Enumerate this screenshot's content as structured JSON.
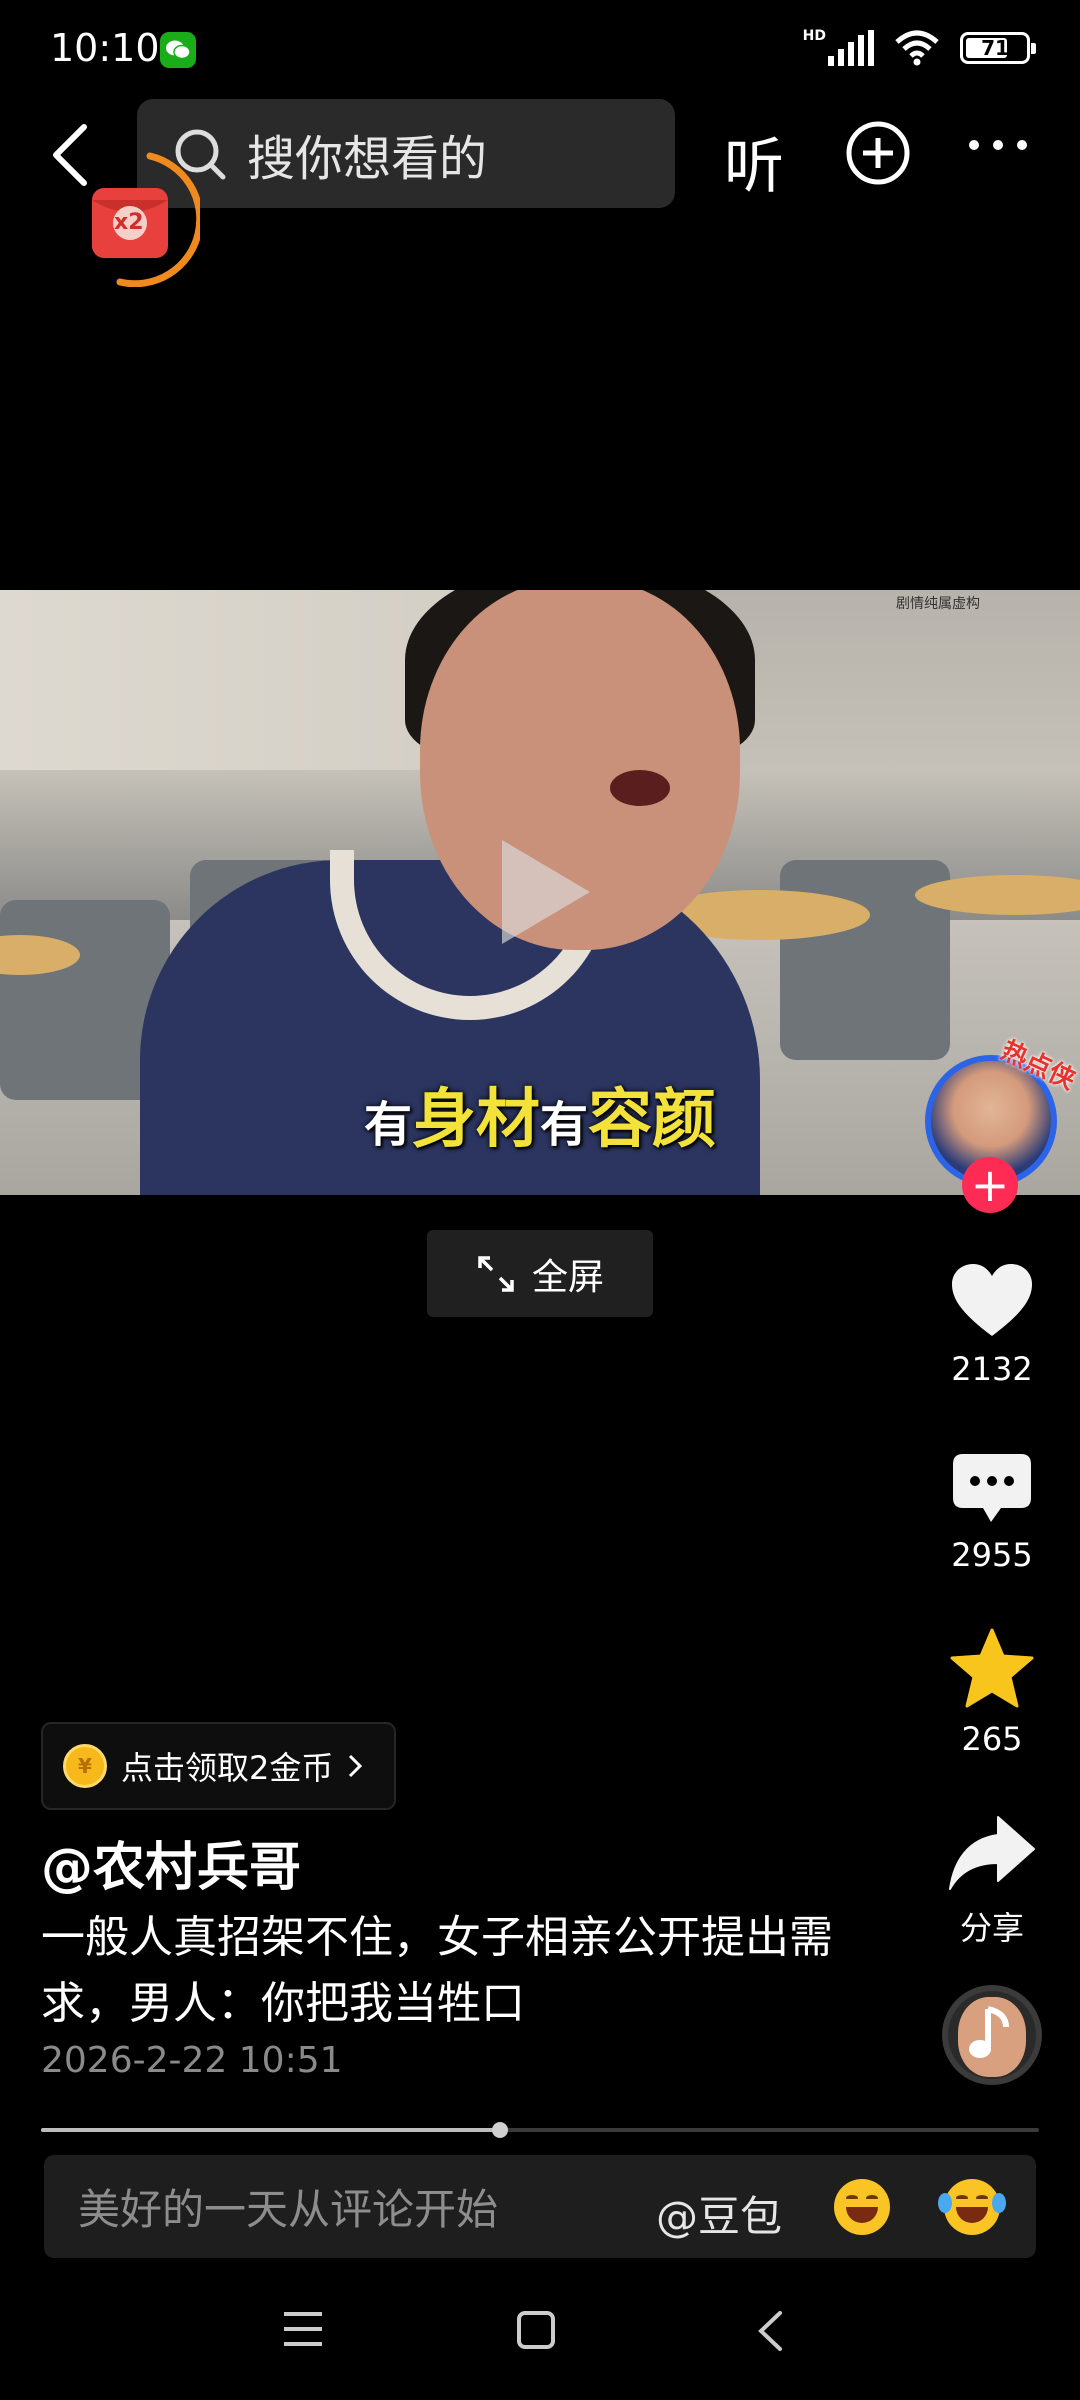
{
  "status_bar": {
    "time": "10:10",
    "network": "HD",
    "battery": "71",
    "battery_level": 0.71
  },
  "top_nav": {
    "search_placeholder": "搜你想看的",
    "listen_label": "听",
    "coin_badge_text": "x2"
  },
  "video": {
    "subtitle_part1": "有",
    "subtitle_part2": "身材",
    "subtitle_part3": "有",
    "subtitle_part4": "容颜",
    "watermark": "剧情纯属虚构",
    "fullscreen_label": "全屏"
  },
  "rail": {
    "hot_tag": "热点侠",
    "like_count": "2132",
    "comment_count": "2955",
    "favorite_count": "265",
    "share_label": "分享"
  },
  "info": {
    "coin_claim_label": "点击领取2金币",
    "username": "@农村兵哥",
    "caption": "一般人真招架不住，女子相亲公开提出需求，男人：你把我当牲口",
    "date": "2026-2-22 10:51",
    "progress": 0.46
  },
  "comment_bar": {
    "placeholder": "美好的一天从评论开始",
    "mention": "@豆包"
  },
  "colors": {
    "accent_red": "#fe2c55",
    "favorite_yellow": "#f7c51c",
    "subtitle_highlight": "#f3e23a"
  }
}
